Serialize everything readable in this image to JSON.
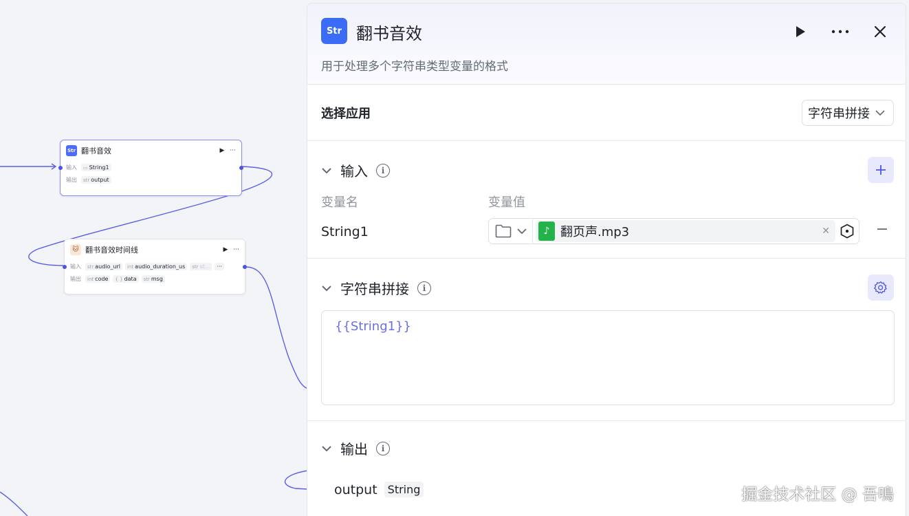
{
  "canvas": {
    "nodes": [
      {
        "title": "翻书音效",
        "icon": "Str",
        "input_label": "输入",
        "output_label": "输出",
        "inputs": [
          "String1"
        ],
        "outputs": [
          {
            "type": "str",
            "name": "output"
          }
        ]
      },
      {
        "title": "翻书音效时间线",
        "input_label": "输入",
        "output_label": "输出",
        "inputs": [
          {
            "type": "str",
            "name": "audio_url"
          },
          {
            "type": "int",
            "name": "audio_duration_us"
          },
          {
            "type": "str",
            "name": "st..."
          }
        ],
        "outputs": [
          {
            "type": "int",
            "name": "code"
          },
          {
            "type": "{ }",
            "name": "data"
          },
          {
            "type": "str",
            "name": "msg"
          }
        ],
        "more": "···"
      }
    ]
  },
  "panel": {
    "icon": "Str",
    "title": "翻书音效",
    "description": "用于处理多个字符串类型变量的格式",
    "app_section": {
      "label": "选择应用",
      "selected": "字符串拼接"
    },
    "input_section": {
      "title": "输入",
      "col_name": "变量名",
      "col_value": "变量值",
      "variables": [
        {
          "name": "String1",
          "file": "翻页声.mp3"
        }
      ]
    },
    "concat_section": {
      "title": "字符串拼接",
      "template": "{{String1}}"
    },
    "output_section": {
      "title": "输出",
      "name": "output",
      "type": "String"
    }
  },
  "watermark": "掘金技术社区 @ 吾鳴",
  "colors": {
    "accent": "#4d53e8",
    "edge": "#5a5fe6",
    "file_icon": "#24b34b",
    "app_icon": "#3b6cf5"
  }
}
